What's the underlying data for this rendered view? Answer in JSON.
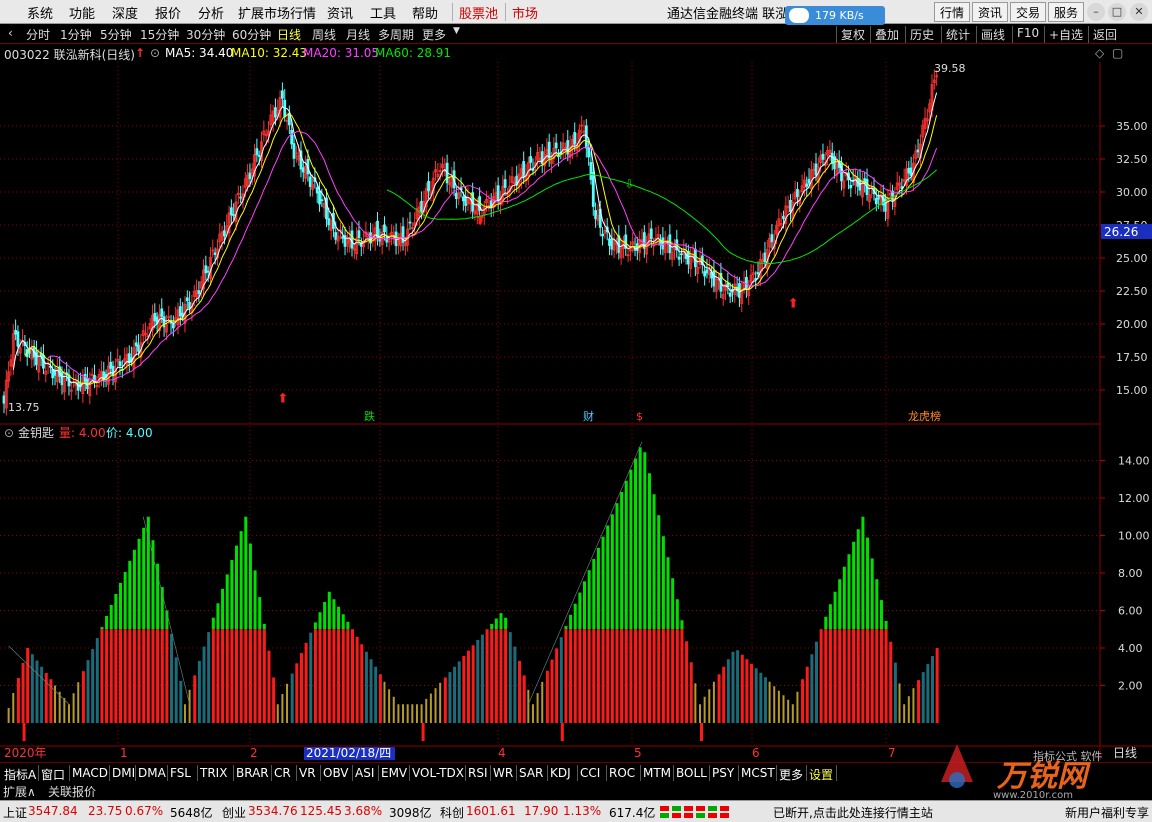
{
  "menu": {
    "items": [
      "系统",
      "功能",
      "深度",
      "报价",
      "分析",
      "扩展市场行情",
      "资讯",
      "工具",
      "帮助",
      "股票池",
      "市场"
    ],
    "title": "通达信金融终端  联泓",
    "cloud": "179 KB/s",
    "right_buttons": [
      "行情",
      "资讯",
      "交易",
      "服务"
    ]
  },
  "toolbar": {
    "periods": [
      "分时",
      "1分钟",
      "5分钟",
      "15分钟",
      "30分钟",
      "60分钟",
      "日线",
      "周线",
      "月线",
      "多周期",
      "更多"
    ],
    "right": [
      "复权",
      "叠加",
      "历史",
      "统计",
      "画线",
      "F10",
      "+自选",
      "返回"
    ]
  },
  "info": {
    "code_name": "003022 联泓新科(日线)",
    "ma5": "MA5: 34.40",
    "ma10": "MA10: 32.43",
    "ma20": "MA20: 31.05",
    "ma60": "MA60: 28.91"
  },
  "indicator": {
    "name": "金钥匙",
    "vol": "量: 4.00",
    "price": "价: 4.00"
  },
  "axis": {
    "price_ticks": [
      "35.00",
      "32.50",
      "30.00",
      "27.50",
      "25.00",
      "22.50",
      "20.00",
      "17.50",
      "15.00"
    ],
    "ind_ticks": [
      "14.00",
      "12.00",
      "10.00",
      "8.00",
      "6.00",
      "4.00",
      "2.00"
    ],
    "current_price": "26.26",
    "high_label": "39.58",
    "low_label": "13.75",
    "date_labels": [
      "2020年",
      "1",
      "2",
      "2021/02/18/四",
      "4",
      "5",
      "6",
      "7"
    ],
    "period": "日线"
  },
  "markers": {
    "m1": "跌",
    "m2": "财",
    "m3": "$",
    "m4": "龙虎榜"
  },
  "periods_tabs": [
    "指标A",
    "窗口",
    "MACD",
    "DMI",
    "DMA",
    "FSL",
    "TRIX",
    "BRAR",
    "CR",
    "VR",
    "OBV",
    "ASI",
    "EMV",
    "VOL-TDX",
    "RSI",
    "WR",
    "SAR",
    "KDJ",
    "CCI",
    "ROC",
    "MTM",
    "BOLL",
    "PSY",
    "MCST",
    "更多",
    "设置"
  ],
  "expand": {
    "a": "扩展∧",
    "b": "关联报价"
  },
  "status": {
    "sh_label": "上证",
    "sh_val": "3547.84",
    "sh_chg": "23.75",
    "sh_pct": "0.67%",
    "sh_amt": "5648亿",
    "cy_label": "创业",
    "cy_val": "3534.76",
    "cy_chg": "125.45",
    "cy_pct": "3.68%",
    "cy_amt": "3098亿",
    "kc_label": "科创",
    "kc_val": "1601.61",
    "kc_chg": "17.90",
    "kc_pct": "1.13%",
    "kc_amt": "617.4亿",
    "conn": "已断开,点击此处连接行情主站",
    "note": "新用户福利专享"
  },
  "watermark": {
    "brand": "万锐网",
    "url": "www.2010r.com",
    "extra": "指标公式 软件"
  },
  "colors": {
    "up": "#ff3232",
    "down": "#54ffff",
    "ma5": "#ffffff",
    "ma10": "#ffff00",
    "ma20": "#ff40ff",
    "ma60": "#00e600",
    "grid": "#8b0000"
  }
}
